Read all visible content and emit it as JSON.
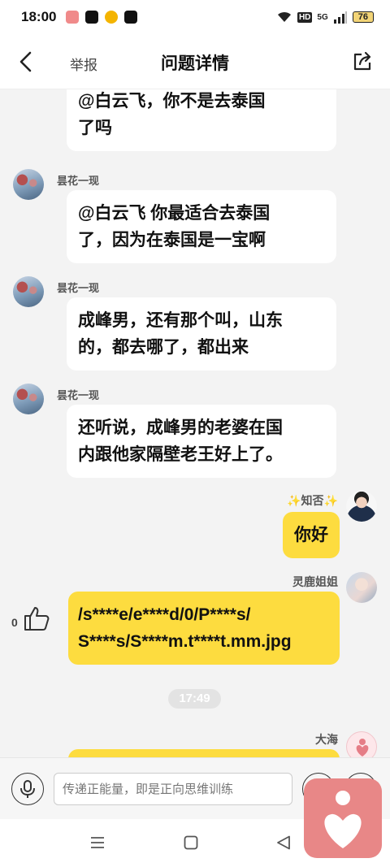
{
  "status_bar": {
    "time": "18:00",
    "network": "5G",
    "hd": "HD",
    "battery": "76"
  },
  "header": {
    "report_label": "举报",
    "title": "问题详情"
  },
  "messages": [
    {
      "sender": "",
      "lines": [
        "@白云飞，你不是去泰国",
        "了吗"
      ]
    },
    {
      "sender": "昙花一现",
      "lines": [
        "@白云飞 你最适合去泰国",
        "了，因为在泰国是一宝啊"
      ]
    },
    {
      "sender": "昙花一现",
      "lines": [
        "成峰男，还有那个叫，山东",
        "的，都去哪了，都出来"
      ]
    },
    {
      "sender": "昙花一现",
      "lines": [
        "还听说，成峰男的老婆在国",
        "内跟他家隔壁老王好上了。"
      ]
    },
    {
      "sender": "✨知否✨",
      "lines": [
        "你好"
      ]
    },
    {
      "sender": "灵鹿姐姐",
      "lines": [
        "/s****e/e****d/0/P****s/",
        "S****s/S****m.t****t.mm.jpg"
      ],
      "likes": "0"
    },
    {
      "sender": "大海",
      "lines": []
    }
  ],
  "timestamp": "17:49",
  "input": {
    "placeholder": "传递正能量，即是正向思维训练"
  },
  "icons": {
    "back": "chevron-left-icon",
    "share": "share-icon",
    "mic": "microphone-icon",
    "like": "thumbs-up-icon",
    "emoji": "emoji-icon",
    "plus": "plus-icon"
  },
  "colors": {
    "bubble_self": "#fddc3f",
    "bubble_other": "#ffffff",
    "background": "#f3f3f3",
    "float_app": "#e88787"
  }
}
